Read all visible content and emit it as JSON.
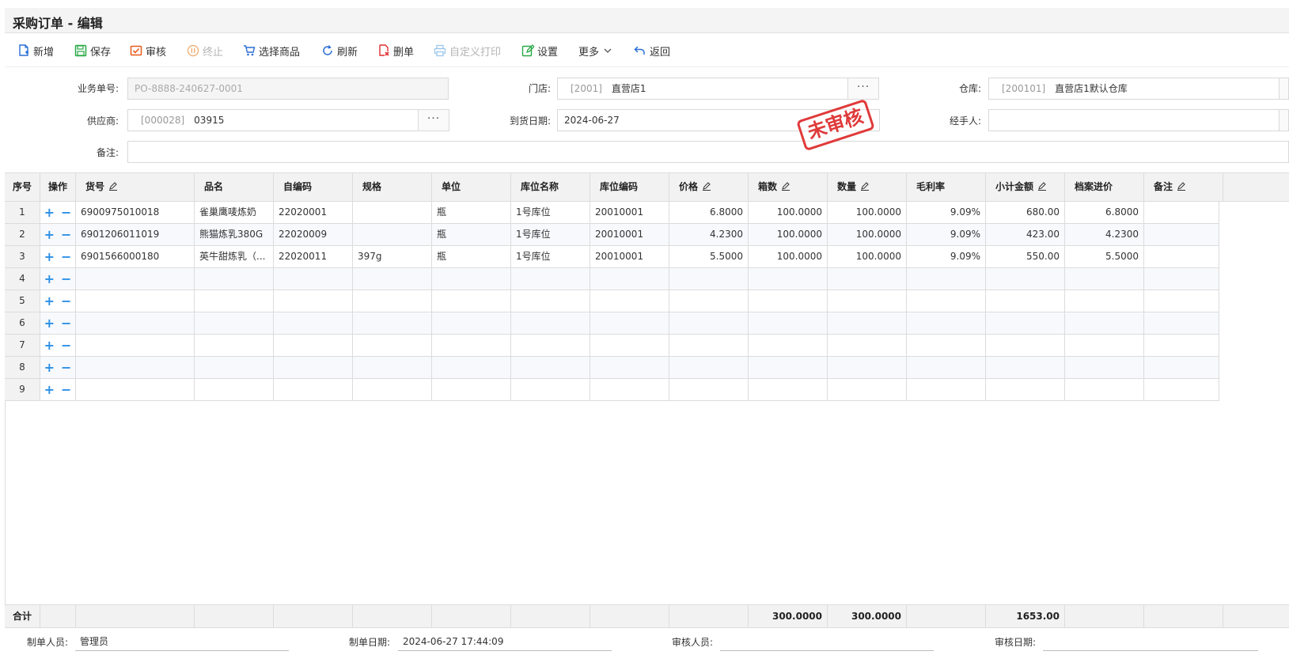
{
  "title": "采购订单 - 编辑",
  "toolbar": {
    "new": "新增",
    "save": "保存",
    "audit": "审核",
    "terminate": "终止",
    "select_goods": "选择商品",
    "refresh": "刷新",
    "delete": "删单",
    "custom_print": "自定义打印",
    "settings": "设置",
    "more": "更多",
    "back": "返回"
  },
  "form": {
    "order_no_label": "业务单号:",
    "order_no": "PO-8888-240627-0001",
    "store_label": "门店:",
    "store_code": "[2001]",
    "store_name": "直营店1",
    "warehouse_label": "仓库:",
    "warehouse_code": "[200101]",
    "warehouse_name": "直营店1默认仓库",
    "supplier_label": "供应商:",
    "supplier_code": "[000028]",
    "supplier_name": "03915",
    "arrival_date_label": "到货日期:",
    "arrival_date": "2024-06-27",
    "handler_label": "经手人:",
    "handler": "",
    "remark_label": "备注:",
    "remark": "",
    "dots": "···"
  },
  "stamp": "未审核",
  "table": {
    "headers": {
      "seq": "序号",
      "ops": "操作",
      "item_no": "货号",
      "name": "品名",
      "self_code": "自编码",
      "spec": "规格",
      "unit": "单位",
      "loc_name": "库位名称",
      "loc_code": "库位编码",
      "price": "价格",
      "boxes": "箱数",
      "qty": "数量",
      "margin": "毛利率",
      "subtotal": "小计金额",
      "file_price": "档案进价",
      "note": "备注"
    },
    "op_add": "+",
    "op_remove": "−",
    "rows": [
      {
        "seq": "1",
        "item_no": "6900975010018",
        "name": "雀巢鹰唛炼奶",
        "self_code": "22020001",
        "spec": "",
        "unit": "瓶",
        "loc_name": "1号库位",
        "loc_code": "20010001",
        "price": "6.8000",
        "boxes": "100.0000",
        "qty": "100.0000",
        "margin": "9.09%",
        "subtotal": "680.00",
        "file_price": "6.8000",
        "note": ""
      },
      {
        "seq": "2",
        "item_no": "6901206011019",
        "name": "熊猫炼乳380G",
        "self_code": "22020009",
        "spec": "",
        "unit": "瓶",
        "loc_name": "1号库位",
        "loc_code": "20010001",
        "price": "4.2300",
        "boxes": "100.0000",
        "qty": "100.0000",
        "margin": "9.09%",
        "subtotal": "423.00",
        "file_price": "4.2300",
        "note": ""
      },
      {
        "seq": "3",
        "item_no": "6901566000180",
        "name": "英牛甜炼乳（...",
        "self_code": "22020011",
        "spec": "397g",
        "unit": "瓶",
        "loc_name": "1号库位",
        "loc_code": "20010001",
        "price": "5.5000",
        "boxes": "100.0000",
        "qty": "100.0000",
        "margin": "9.09%",
        "subtotal": "550.00",
        "file_price": "5.5000",
        "note": ""
      },
      {
        "seq": "4",
        "item_no": "",
        "name": "",
        "self_code": "",
        "spec": "",
        "unit": "",
        "loc_name": "",
        "loc_code": "",
        "price": "",
        "boxes": "",
        "qty": "",
        "margin": "",
        "subtotal": "",
        "file_price": "",
        "note": ""
      },
      {
        "seq": "5",
        "item_no": "",
        "name": "",
        "self_code": "",
        "spec": "",
        "unit": "",
        "loc_name": "",
        "loc_code": "",
        "price": "",
        "boxes": "",
        "qty": "",
        "margin": "",
        "subtotal": "",
        "file_price": "",
        "note": ""
      },
      {
        "seq": "6",
        "item_no": "",
        "name": "",
        "self_code": "",
        "spec": "",
        "unit": "",
        "loc_name": "",
        "loc_code": "",
        "price": "",
        "boxes": "",
        "qty": "",
        "margin": "",
        "subtotal": "",
        "file_price": "",
        "note": ""
      },
      {
        "seq": "7",
        "item_no": "",
        "name": "",
        "self_code": "",
        "spec": "",
        "unit": "",
        "loc_name": "",
        "loc_code": "",
        "price": "",
        "boxes": "",
        "qty": "",
        "margin": "",
        "subtotal": "",
        "file_price": "",
        "note": ""
      },
      {
        "seq": "8",
        "item_no": "",
        "name": "",
        "self_code": "",
        "spec": "",
        "unit": "",
        "loc_name": "",
        "loc_code": "",
        "price": "",
        "boxes": "",
        "qty": "",
        "margin": "",
        "subtotal": "",
        "file_price": "",
        "note": ""
      },
      {
        "seq": "9",
        "item_no": "",
        "name": "",
        "self_code": "",
        "spec": "",
        "unit": "",
        "loc_name": "",
        "loc_code": "",
        "price": "",
        "boxes": "",
        "qty": "",
        "margin": "",
        "subtotal": "",
        "file_price": "",
        "note": ""
      }
    ],
    "total": {
      "label": "合计",
      "boxes": "300.0000",
      "qty": "300.0000",
      "subtotal": "1653.00"
    }
  },
  "footer": {
    "creator_label": "制单人员:",
    "creator": "管理员",
    "created_label": "制单日期:",
    "created": "2024-06-27 17:44:09",
    "auditor_label": "审核人员:",
    "auditor": "",
    "audit_date_label": "审核日期:",
    "audit_date": ""
  },
  "colors": {
    "accent": "#2b8fe6",
    "stamp": "#e03a3a",
    "save": "#27a844",
    "audit": "#e8591a",
    "delete": "#e02d2d"
  }
}
